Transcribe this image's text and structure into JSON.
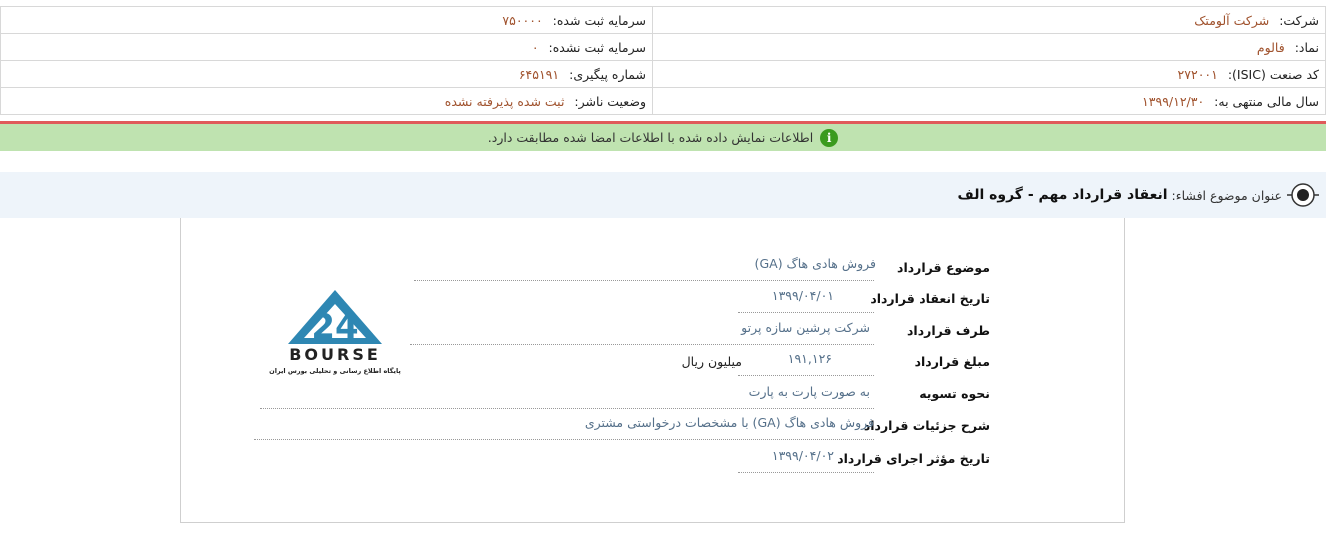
{
  "company_info": {
    "company_label": "شرکت:",
    "company_value": "شرکت آلومتک",
    "capital_registered_label": "سرمایه ثبت شده:",
    "capital_registered_value": "۷۵۰۰۰۰",
    "symbol_label": "نماد:",
    "symbol_value": "فالوم",
    "capital_unregistered_label": "سرمایه ثبت نشده:",
    "capital_unregistered_value": "۰",
    "isic_label": "کد صنعت (ISIC):",
    "isic_value": "۲۷۲۰۰۱",
    "tracking_label": "شماره پیگیری:",
    "tracking_value": "۶۴۵۱۹۱",
    "fiscal_label": "سال مالی منتهی به:",
    "fiscal_value": "۱۳۹۹/۱۲/۳۰",
    "publisher_status_label": "وضعیت ناشر:",
    "publisher_status_value": "ثبت شده پذیرفته نشده"
  },
  "status_message": "اطلاعات نمایش داده شده با اطلاعات امضا شده مطابقت دارد.",
  "subject": {
    "label": "عنوان موضوع افشاء:",
    "title": "انعقاد قرارداد مهم - گروه الف"
  },
  "contract": {
    "subject_label": "موضوع قرارداد",
    "subject_value": "فروش هادی هاگ (GA)",
    "date_label": "تاریخ انعقاد قرارداد",
    "date_value": "۱۳۹۹/۰۴/۰۱",
    "party_label": "طرف قرارداد",
    "party_value": "شرکت پرشین سازه پرتو",
    "amount_label": "مبلغ قرارداد",
    "amount_value": "۱۹۱,۱۲۶",
    "amount_unit": "میلیون ریال",
    "settlement_label": "نحوه تسویه",
    "settlement_value": "به صورت پارت به پارت",
    "details_label": "شرح جزئیات قرارداد",
    "details_value": "فروش هادی هاگ (GA) با مشخصات درخواستی مشتری",
    "effective_label": "تاریخ مؤثر اجرای قرارداد",
    "effective_value": "۱۳۹۹/۰۴/۰۲"
  },
  "logo": {
    "big_text": "BOURSE",
    "small_text": "پایگاه اطلاع رسانی و تحلیلی بورس ایران",
    "numeral": "24"
  },
  "colors": {
    "status_bg": "#bfe3b0",
    "status_border": "#e05a5a",
    "value_color": "#a0522d",
    "field_value_color": "#55708a",
    "logo_blue": "#2e87b3"
  }
}
